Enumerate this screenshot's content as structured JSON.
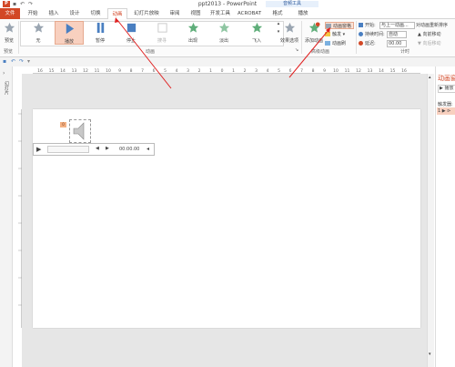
{
  "titlebar": {
    "app_icon": "P",
    "title": "ppt2013 - PowerPoint",
    "context_tab_title": "音频工具"
  },
  "tabs": [
    {
      "label": "文件"
    },
    {
      "label": "开始"
    },
    {
      "label": "插入"
    },
    {
      "label": "设计"
    },
    {
      "label": "切换"
    },
    {
      "label": "动画"
    },
    {
      "label": "幻灯片放映"
    },
    {
      "label": "审阅"
    },
    {
      "label": "视图"
    },
    {
      "label": "开发工具"
    },
    {
      "label": "ACROBAT"
    },
    {
      "label": "格式"
    },
    {
      "label": "播放"
    }
  ],
  "ribbon": {
    "preview_label": "预览",
    "preview_group": "预览",
    "animations": [
      {
        "label": "无"
      },
      {
        "label": "播放"
      },
      {
        "label": "暂停"
      },
      {
        "label": "停止"
      },
      {
        "label": "搜寻"
      },
      {
        "label": "出现"
      },
      {
        "label": "淡出"
      },
      {
        "label": "飞入"
      }
    ],
    "effect_options_label": "效果选项",
    "animation_group": "动画",
    "add_animation_label": "添加动画",
    "animation_pane_label": "动画窗格",
    "trigger_label": "触发",
    "painter_label": "动画刷",
    "advanced_group": "高级动画",
    "start_label": "开始:",
    "start_value": "与上一动画...",
    "duration_label": "持续时间:",
    "duration_value": "自动",
    "delay_label": "延迟:",
    "delay_value": "00.00",
    "timing_group": "计时",
    "reorder_label": "对动画重新排序",
    "move_earlier_label": "向前移动",
    "move_later_label": "向后移动"
  },
  "ruler": {
    "ticks": [
      "16",
      "15",
      "14",
      "13",
      "12",
      "11",
      "10",
      "9",
      "8",
      "7",
      "6",
      "5",
      "4",
      "3",
      "2",
      "1",
      "0",
      "1",
      "2",
      "3",
      "4",
      "5",
      "6",
      "7",
      "8",
      "9",
      "10",
      "11",
      "12",
      "13",
      "14",
      "15",
      "16"
    ]
  },
  "left_pane": {
    "label": "幻灯片"
  },
  "player": {
    "time": "00:00.00"
  },
  "slide": {
    "anim_badge": "0"
  },
  "right_pane": {
    "title": "动画窗",
    "play_label": "播放",
    "trigger_text": "触发器:",
    "item_num": "1"
  },
  "colors": {
    "accent": "#d24726",
    "arrow": "#e02020",
    "selected": "#f8d0bf"
  }
}
